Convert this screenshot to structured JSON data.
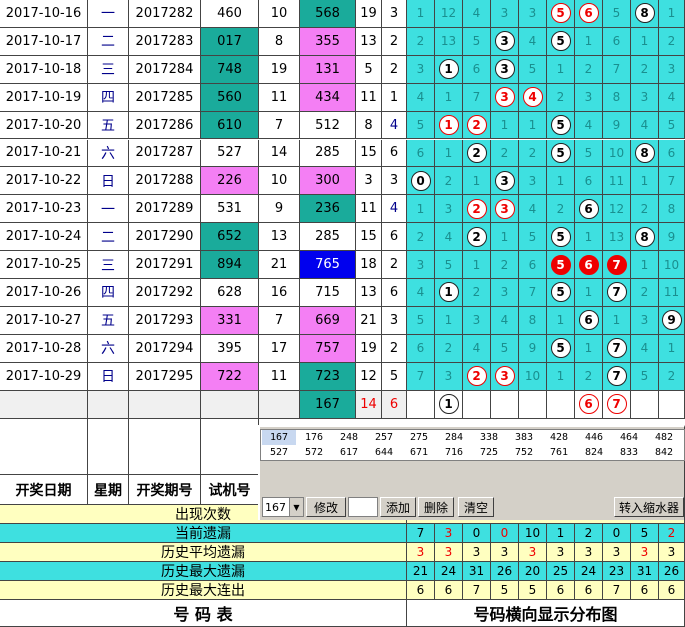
{
  "colors": {
    "cyan": "#3ee0e0",
    "teal": "#1aab9b",
    "magenta": "#f47ff4",
    "blue": "#0000ee",
    "yellow": "#ffffc0",
    "miss": "#1a8f8f",
    "red": "#ee0000"
  },
  "rows": [
    {
      "date": "2017-10-16",
      "wd": "一",
      "issue": "2017282",
      "trial": "460",
      "sum": "10",
      "draw": "568",
      "dsum": "19",
      "span": "3",
      "tbg": "w",
      "dbg": "teal",
      "misses": [
        "1",
        "12",
        "4",
        "3",
        "3",
        "",
        "",
        "5",
        "",
        "1"
      ],
      "hits": [
        {
          "i": 5,
          "n": "5",
          "s": "ro"
        },
        {
          "i": 6,
          "n": "6",
          "s": "ro"
        },
        {
          "i": 8,
          "n": "8",
          "s": "w"
        }
      ]
    },
    {
      "date": "2017-10-17",
      "wd": "二",
      "issue": "2017283",
      "trial": "017",
      "sum": "8",
      "draw": "355",
      "dsum": "13",
      "span": "2",
      "tbg": "teal",
      "dbg": "mag",
      "misses": [
        "2",
        "13",
        "5",
        "",
        "4",
        "",
        "1",
        "6",
        "1",
        "2"
      ],
      "hits": [
        {
          "i": 3,
          "n": "3",
          "s": "w"
        },
        {
          "i": 5,
          "n": "5",
          "s": "w"
        }
      ]
    },
    {
      "date": "2017-10-18",
      "wd": "三",
      "issue": "2017284",
      "trial": "748",
      "sum": "19",
      "draw": "131",
      "dsum": "5",
      "span": "2",
      "tbg": "teal",
      "dbg": "mag",
      "misses": [
        "3",
        "",
        "6",
        "",
        "5",
        "1",
        "2",
        "7",
        "2",
        "3"
      ],
      "hits": [
        {
          "i": 1,
          "n": "1",
          "s": "w"
        },
        {
          "i": 3,
          "n": "3",
          "s": "w"
        }
      ]
    },
    {
      "date": "2017-10-19",
      "wd": "四",
      "issue": "2017285",
      "trial": "560",
      "sum": "11",
      "draw": "434",
      "dsum": "11",
      "span": "1",
      "tbg": "teal",
      "dbg": "mag",
      "misses": [
        "4",
        "1",
        "7",
        "",
        "",
        "2",
        "3",
        "8",
        "3",
        "4"
      ],
      "hits": [
        {
          "i": 3,
          "n": "3",
          "s": "ro"
        },
        {
          "i": 4,
          "n": "4",
          "s": "ro"
        }
      ]
    },
    {
      "date": "2017-10-20",
      "wd": "五",
      "issue": "2017286",
      "trial": "610",
      "sum": "7",
      "draw": "512",
      "dsum": "8",
      "span": "4",
      "tbg": "teal",
      "dbg": "w",
      "misses": [
        "5",
        "",
        "",
        "1",
        "1",
        "",
        "4",
        "9",
        "4",
        "5"
      ],
      "hits": [
        {
          "i": 1,
          "n": "1",
          "s": "ro"
        },
        {
          "i": 2,
          "n": "2",
          "s": "ro"
        },
        {
          "i": 5,
          "n": "5",
          "s": "w"
        }
      ]
    },
    {
      "date": "2017-10-21",
      "wd": "六",
      "issue": "2017287",
      "trial": "527",
      "sum": "14",
      "draw": "285",
      "dsum": "15",
      "span": "6",
      "tbg": "w",
      "dbg": "w",
      "misses": [
        "6",
        "1",
        "",
        "2",
        "2",
        "",
        "5",
        "10",
        "",
        "6"
      ],
      "hits": [
        {
          "i": 2,
          "n": "2",
          "s": "w"
        },
        {
          "i": 5,
          "n": "5",
          "s": "w"
        },
        {
          "i": 8,
          "n": "8",
          "s": "w"
        }
      ]
    },
    {
      "date": "2017-10-22",
      "wd": "日",
      "issue": "2017288",
      "trial": "226",
      "sum": "10",
      "draw": "300",
      "dsum": "3",
      "span": "3",
      "tbg": "mag",
      "dbg": "mag",
      "misses": [
        "",
        "2",
        "1",
        "",
        "3",
        "1",
        "6",
        "11",
        "1",
        "7"
      ],
      "hits": [
        {
          "i": 0,
          "n": "0",
          "s": "w"
        },
        {
          "i": 3,
          "n": "3",
          "s": "w"
        }
      ]
    },
    {
      "date": "2017-10-23",
      "wd": "一",
      "issue": "2017289",
      "trial": "531",
      "sum": "9",
      "draw": "236",
      "dsum": "11",
      "span": "4",
      "tbg": "w",
      "dbg": "teal",
      "misses": [
        "1",
        "3",
        "",
        "",
        "4",
        "2",
        "",
        "12",
        "2",
        "8"
      ],
      "hits": [
        {
          "i": 2,
          "n": "2",
          "s": "ro"
        },
        {
          "i": 3,
          "n": "3",
          "s": "ro"
        },
        {
          "i": 6,
          "n": "6",
          "s": "w"
        }
      ]
    },
    {
      "date": "2017-10-24",
      "wd": "二",
      "issue": "2017290",
      "trial": "652",
      "sum": "13",
      "draw": "285",
      "dsum": "15",
      "span": "6",
      "tbg": "teal",
      "dbg": "w",
      "misses": [
        "2",
        "4",
        "",
        "1",
        "5",
        "",
        "1",
        "13",
        "",
        "9"
      ],
      "hits": [
        {
          "i": 2,
          "n": "2",
          "s": "w"
        },
        {
          "i": 5,
          "n": "5",
          "s": "w"
        },
        {
          "i": 8,
          "n": "8",
          "s": "w"
        }
      ]
    },
    {
      "date": "2017-10-25",
      "wd": "三",
      "issue": "2017291",
      "trial": "894",
      "sum": "21",
      "draw": "765",
      "dsum": "18",
      "span": "2",
      "tbg": "teal",
      "dbg": "blue",
      "misses": [
        "3",
        "5",
        "1",
        "2",
        "6",
        "",
        "",
        "",
        "1",
        "10"
      ],
      "hits": [
        {
          "i": 5,
          "n": "5",
          "s": "rf"
        },
        {
          "i": 6,
          "n": "6",
          "s": "rf"
        },
        {
          "i": 7,
          "n": "7",
          "s": "rf"
        }
      ]
    },
    {
      "date": "2017-10-26",
      "wd": "四",
      "issue": "2017292",
      "trial": "628",
      "sum": "16",
      "draw": "715",
      "dsum": "13",
      "span": "6",
      "tbg": "w",
      "dbg": "w",
      "misses": [
        "4",
        "",
        "2",
        "3",
        "7",
        "",
        "1",
        "",
        "2",
        "11"
      ],
      "hits": [
        {
          "i": 1,
          "n": "1",
          "s": "w"
        },
        {
          "i": 5,
          "n": "5",
          "s": "w"
        },
        {
          "i": 7,
          "n": "7",
          "s": "w"
        }
      ]
    },
    {
      "date": "2017-10-27",
      "wd": "五",
      "issue": "2017293",
      "trial": "331",
      "sum": "7",
      "draw": "669",
      "dsum": "21",
      "span": "3",
      "tbg": "mag",
      "dbg": "mag",
      "misses": [
        "5",
        "1",
        "3",
        "4",
        "8",
        "1",
        "",
        "1",
        "3",
        ""
      ],
      "hits": [
        {
          "i": 6,
          "n": "6",
          "s": "w"
        },
        {
          "i": 9,
          "n": "9",
          "s": "w"
        }
      ]
    },
    {
      "date": "2017-10-28",
      "wd": "六",
      "issue": "2017294",
      "trial": "395",
      "sum": "17",
      "draw": "757",
      "dsum": "19",
      "span": "2",
      "tbg": "w",
      "dbg": "mag",
      "misses": [
        "6",
        "2",
        "4",
        "5",
        "9",
        "",
        "1",
        "",
        "4",
        "1"
      ],
      "hits": [
        {
          "i": 5,
          "n": "5",
          "s": "w"
        },
        {
          "i": 7,
          "n": "7",
          "s": "w"
        }
      ]
    },
    {
      "date": "2017-10-29",
      "wd": "日",
      "issue": "2017295",
      "trial": "722",
      "sum": "11",
      "draw": "723",
      "dsum": "12",
      "span": "5",
      "tbg": "mag",
      "dbg": "teal",
      "misses": [
        "7",
        "3",
        "",
        "",
        "10",
        "1",
        "2",
        "",
        "5",
        "2"
      ],
      "hits": [
        {
          "i": 2,
          "n": "2",
          "s": "ro"
        },
        {
          "i": 3,
          "n": "3",
          "s": "ro"
        },
        {
          "i": 7,
          "n": "7",
          "s": "w"
        }
      ]
    }
  ],
  "forecast": {
    "draw": "167",
    "dsum": "14",
    "span": "6",
    "hits": [
      {
        "i": 1,
        "n": "1",
        "s": "w"
      },
      {
        "i": 6,
        "n": "6",
        "s": "ro"
      },
      {
        "i": 7,
        "n": "7",
        "s": "ro"
      }
    ]
  },
  "headers": {
    "date": "开奖日期",
    "weekday": "星期",
    "issue": "开奖期号",
    "trial": "试机号"
  },
  "stats": [
    {
      "label": "出现次数",
      "bg": "#ffffc0",
      "vals": [],
      "red": []
    },
    {
      "label": "当前遗漏",
      "bg": "#3ee0e0",
      "vals": [
        "7",
        "3",
        "0",
        "0",
        "10",
        "1",
        "2",
        "0",
        "5",
        "2"
      ],
      "red": [
        1,
        3,
        9
      ]
    },
    {
      "label": "历史平均遗漏",
      "bg": "#ffffc0",
      "vals": [
        "3",
        "3",
        "3",
        "3",
        "3",
        "3",
        "3",
        "3",
        "3",
        "3"
      ],
      "red": [
        0,
        1,
        4,
        8
      ]
    },
    {
      "label": "历史最大遗漏",
      "bg": "#3ee0e0",
      "vals": [
        "21",
        "24",
        "31",
        "26",
        "20",
        "25",
        "24",
        "23",
        "31",
        "26"
      ],
      "red": []
    },
    {
      "label": "历史最大连出",
      "bg": "#ffffc0",
      "vals": [
        "6",
        "6",
        "7",
        "5",
        "5",
        "6",
        "6",
        "7",
        "6",
        "6"
      ],
      "red": []
    }
  ],
  "footer": {
    "left": "号  码  表",
    "right": "号码横向显示分布图"
  },
  "panel": {
    "grid": [
      "167",
      "176",
      "248",
      "257",
      "275",
      "284",
      "338",
      "383",
      "428",
      "446",
      "464",
      "482",
      "527",
      "572",
      "617",
      "644",
      "671",
      "716",
      "725",
      "752",
      "761",
      "824",
      "833",
      "842"
    ],
    "select": "167",
    "modify": "修改",
    "input": "",
    "add": "添加",
    "delete": "删除",
    "clear": "清空",
    "transfer": "转入缩水器"
  }
}
